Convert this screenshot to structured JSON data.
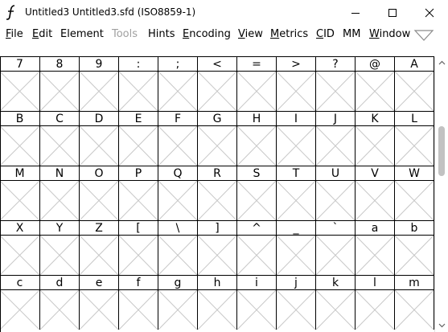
{
  "window": {
    "title": "Untitled3  Untitled3.sfd (ISO8859-1)"
  },
  "menu": [
    {
      "label": "File",
      "acc": "F",
      "rest": "ile",
      "disabled": false
    },
    {
      "label": "Edit",
      "acc": "E",
      "rest": "dit",
      "disabled": false
    },
    {
      "label": "Element",
      "acc": "",
      "rest": "Element",
      "disabled": false
    },
    {
      "label": "Tools",
      "acc": "",
      "rest": "Tools",
      "disabled": true
    },
    {
      "label": "Hints",
      "acc": "",
      "rest": "Hints",
      "disabled": false
    },
    {
      "label": "Encoding",
      "acc": "E",
      "rest": "ncoding",
      "disabled": false
    },
    {
      "label": "View",
      "acc": "V",
      "rest": "iew",
      "disabled": false
    },
    {
      "label": "Metrics",
      "acc": "M",
      "rest": "etrics",
      "disabled": false
    },
    {
      "label": "CID",
      "acc": "C",
      "rest": "ID",
      "disabled": false
    },
    {
      "label": "MM",
      "acc": "",
      "rest": "MM",
      "disabled": false
    },
    {
      "label": "Window",
      "acc": "W",
      "rest": "indow",
      "disabled": false
    }
  ],
  "icons": {
    "app": "fontforge-icon",
    "minimize": "minimize-icon",
    "maximize": "maximize-icon",
    "close": "close-icon",
    "menu_more": "chevron-down-icon"
  },
  "colors": {
    "grid_line": "#000000",
    "cross_line": "#c8c8c8",
    "disabled_text": "#a0a0a0"
  },
  "glyph_rows": [
    [
      "7",
      "8",
      "9",
      ":",
      ";",
      "<",
      "=",
      ">",
      "?",
      "@",
      "A"
    ],
    [
      "B",
      "C",
      "D",
      "E",
      "F",
      "G",
      "H",
      "I",
      "J",
      "K",
      "L"
    ],
    [
      "M",
      "N",
      "O",
      "P",
      "Q",
      "R",
      "S",
      "T",
      "U",
      "V",
      "W"
    ],
    [
      "X",
      "Y",
      "Z",
      "[",
      "\\",
      "]",
      "^",
      "_",
      "`",
      "a",
      "b"
    ],
    [
      "c",
      "d",
      "e",
      "f",
      "g",
      "h",
      "i",
      "j",
      "k",
      "l",
      "m"
    ]
  ],
  "scroll": {
    "position": 0.29
  }
}
